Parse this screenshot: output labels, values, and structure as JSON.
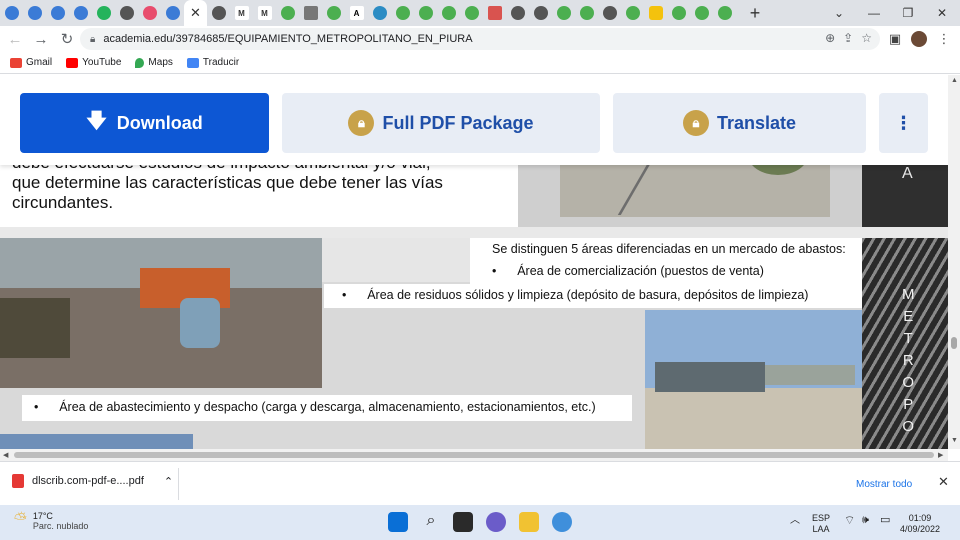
{
  "browser": {
    "tabs_count": 33,
    "active_tab_close": "✕",
    "new_tab": "+",
    "url": "academia.edu/39784685/EQUIPAMIENTO_METROPOLITANO_EN_PIURA",
    "bookmarks": [
      {
        "label": "Gmail",
        "color": "#ea4335"
      },
      {
        "label": "YouTube",
        "color": "#ff0000"
      },
      {
        "label": "Maps",
        "color": "#34a853"
      },
      {
        "label": "Traducir",
        "color": "#4285f4"
      }
    ]
  },
  "actions": {
    "download": "Download",
    "full_pdf": "Full PDF Package",
    "translate": "Translate",
    "more": "⋮"
  },
  "document": {
    "para_lines": [
      "debe efectuarse estudios de impacto ambiental y/o vial,",
      "que determine las características que debe tener las vías",
      "circundantes."
    ],
    "areas_title": "Se distinguen 5 áreas diferenciadas en un mercado de abastos:",
    "bullets": [
      "Área de comercialización (puestos de venta)",
      "Área de residuos sólidos y limpieza (depósito de basura, depósitos de limpieza)",
      "Área de abastecimiento y despacho (carga y descarga, almacenamiento, estacionamientos, etc.)"
    ],
    "side_letters_top": "A",
    "side_letters": [
      "M",
      "E",
      "T",
      "R",
      "O",
      "P",
      "O"
    ]
  },
  "download_bar": {
    "file": "dlscrib.com-pdf-e....pdf",
    "show_all": "Mostrar todo"
  },
  "taskbar": {
    "temp": "17°C",
    "weather": "Parc. nublado",
    "lang1": "ESP",
    "lang2": "LAA",
    "time": "01:09",
    "date": "4/09/2022"
  }
}
